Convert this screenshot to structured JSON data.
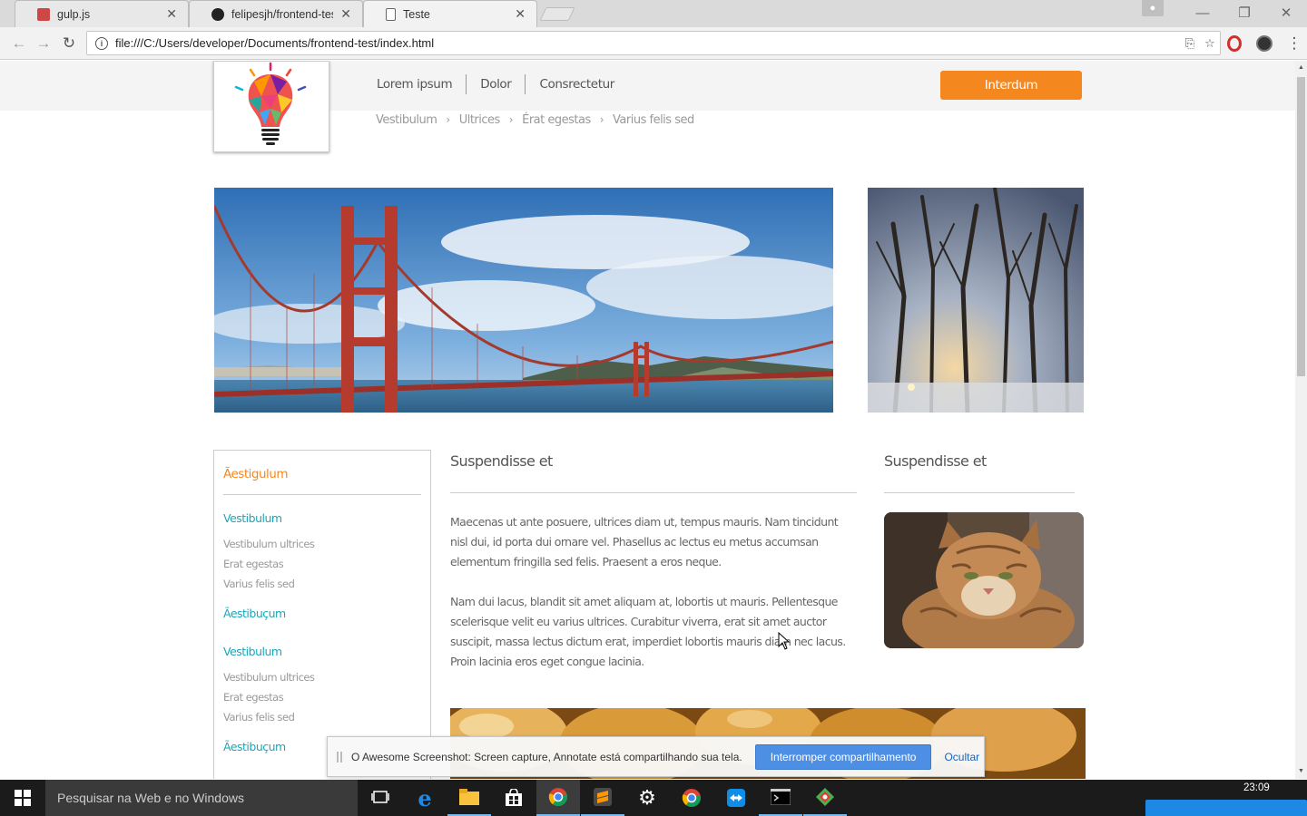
{
  "browser": {
    "tabs": [
      {
        "title": "gulp.js",
        "favicon": "gulp-icon",
        "active": false
      },
      {
        "title": "felipesjh/frontend-test",
        "favicon": "github-icon",
        "active": false
      },
      {
        "title": "Teste",
        "favicon": "page-icon",
        "active": true
      }
    ],
    "url": "file:///C:/Users/developer/Documents/frontend-test/index.html"
  },
  "site": {
    "nav": [
      "Lorem ipsum",
      "Dolor",
      "Consrectetur"
    ],
    "cta_label": "Interdum",
    "breadcrumb": [
      "Vestibulum",
      "Ultrices",
      "Érat egestas",
      "Varius felis sed"
    ],
    "sidebar": {
      "title": "Ãestigulum",
      "groups": [
        {
          "label": "Vestibulum",
          "items": [
            "Vestibulum ultrices",
            "Erat egestas",
            "Varius felis sed"
          ]
        },
        {
          "label": "Ãestibuçum",
          "items": []
        },
        {
          "label": "Vestibulum",
          "items": [
            "Vestibulum ultrices",
            "Erat egestas",
            "Varius felis sed"
          ]
        },
        {
          "label": "Ãestibuçum",
          "items": []
        }
      ]
    },
    "article": {
      "heading": "Suspendisse et",
      "paragraphs": [
        "Maecenas ut ante posuere, ultrices diam ut, tempus mauris. Nam tincidunt nisl dui, id porta dui ornare vel. Phasellus ac lectus eu metus accumsan elementum fringilla sed felis. Praesent a eros neque.",
        "Nam dui lacus, blandit sit amet aliquam at, lobortis ut mauris. Pellentesque scelerisque velit eu varius ultrices. Curabitur viverra, erat sit amet auctor suscipit, massa lectus dictum erat, imperdiet lobortis mauris diam nec lacus. Proin lacinia eros eget congue lacinia."
      ]
    },
    "aside": {
      "heading": "Suspendisse et"
    }
  },
  "sharebar": {
    "message": "O Awesome Screenshot: Screen capture, Annotate está compartilhando sua tela.",
    "stop_label": "Interromper compartilhamento",
    "hide_label": "Ocultar"
  },
  "taskbar": {
    "search_placeholder": "Pesquisar na Web e no Windows",
    "clock": "23:09"
  },
  "colors": {
    "accent": "#f5871f",
    "link": "#1aa6b7"
  }
}
